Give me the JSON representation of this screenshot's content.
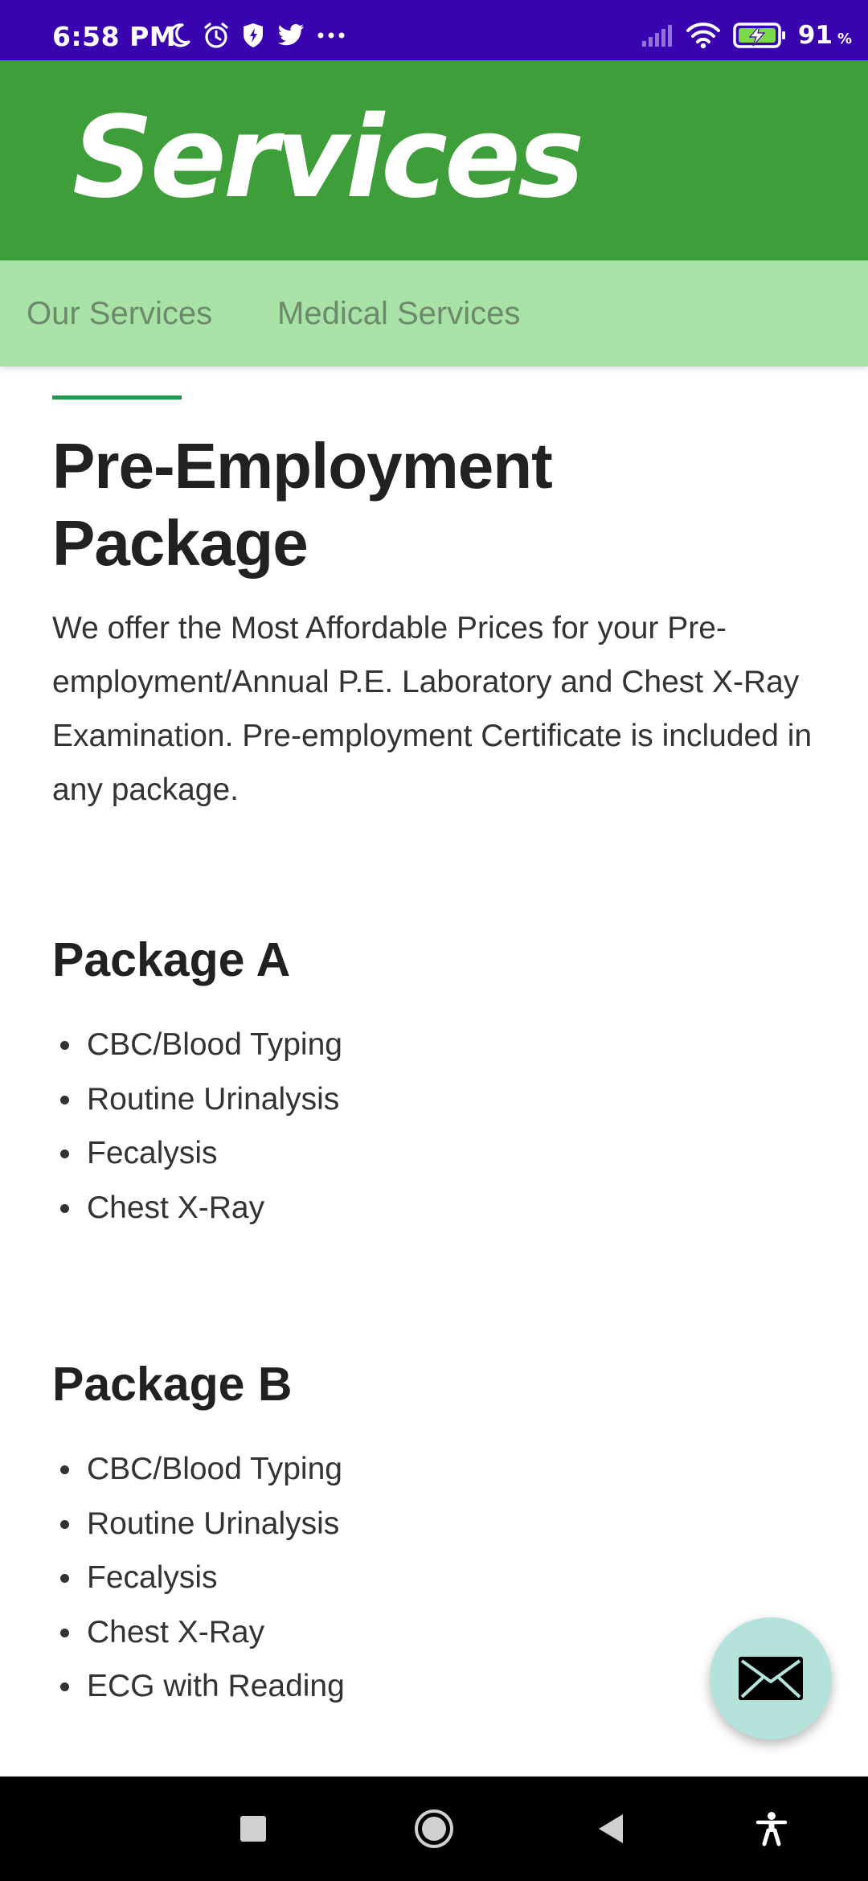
{
  "status_bar": {
    "time": "6:58 PM",
    "battery_percent": "91",
    "battery_unit": "%",
    "icons_left": [
      "moon-icon",
      "alarm-icon",
      "shield-icon",
      "twitter-icon",
      "more-dots-icon"
    ],
    "icons_right": [
      "signal-icon",
      "wifi-icon",
      "battery-charging-icon"
    ]
  },
  "header": {
    "title": "Services",
    "background_color": "#3d9e3a"
  },
  "tabs": [
    {
      "label": "Our Services"
    },
    {
      "label": "Medical Services"
    }
  ],
  "content": {
    "title": "Pre-Employment Package",
    "intro": "We offer the Most Affordable Prices for your Pre-employment/Annual P.E. Laboratory and Chest X-Ray Examination. Pre-employment Certificate is included in any package.",
    "packages": [
      {
        "name": "Package A",
        "items": [
          "CBC/Blood Typing",
          "Routine Urinalysis",
          "Fecalysis",
          "Chest X-Ray"
        ]
      },
      {
        "name": "Package B",
        "items": [
          "CBC/Blood Typing",
          "Routine Urinalysis",
          "Fecalysis",
          "Chest X-Ray",
          "ECG with Reading"
        ]
      }
    ]
  },
  "fab": {
    "icon": "mail-icon",
    "color": "#b5e3dc"
  },
  "nav_bar": {
    "buttons": [
      "recents-icon",
      "home-icon",
      "back-icon",
      "accessibility-icon"
    ]
  },
  "colors": {
    "status_bar": "#3a03b0",
    "tab_bar": "#a8e2a6",
    "accent": "#1e9a4c"
  }
}
